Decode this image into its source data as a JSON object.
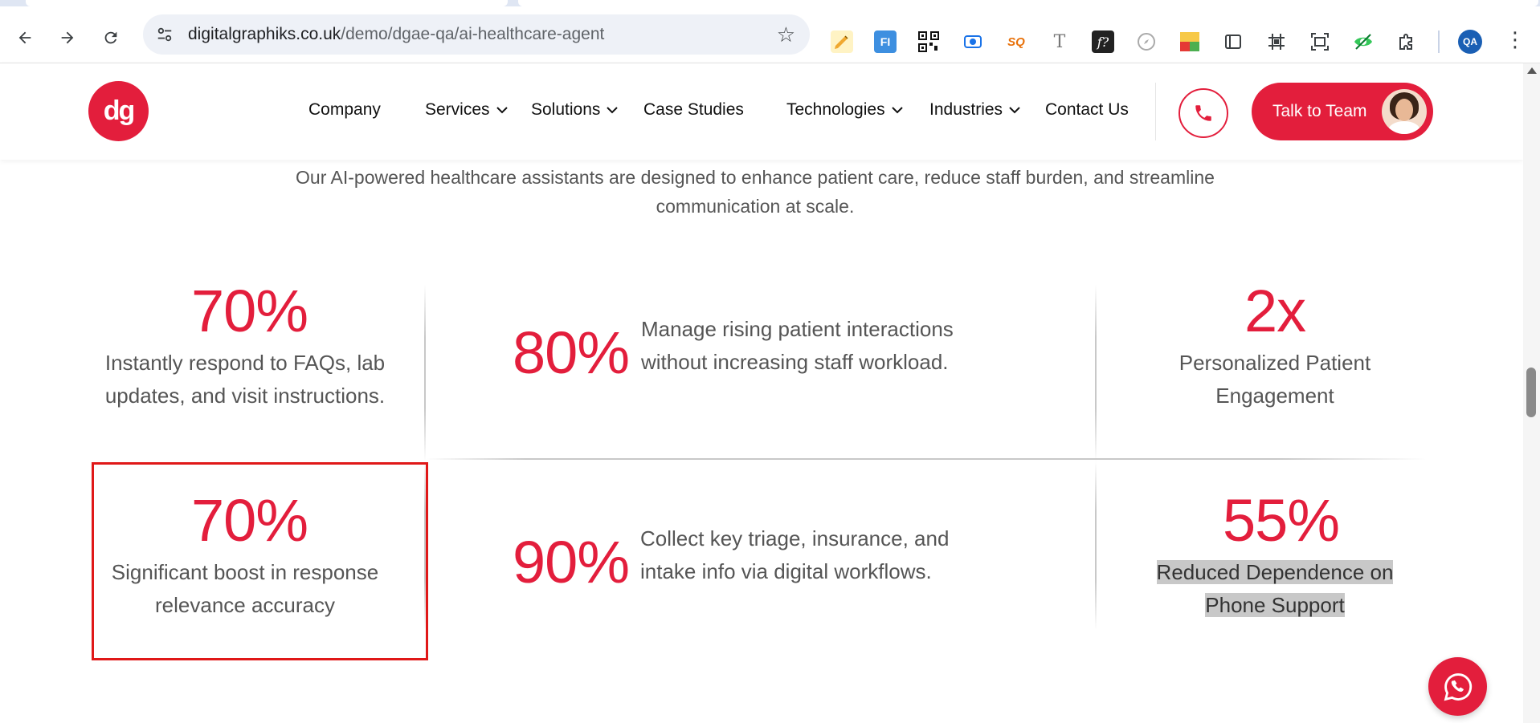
{
  "browser": {
    "url_host": "digitalgraphiks.co.uk",
    "url_path": "/demo/dgae-qa/ai-healthcare-agent",
    "profile_initials": "QA",
    "extensions": [
      "pencil-extension-icon",
      "fi-extension-icon",
      "qr-code-extension-icon",
      "record-extension-icon",
      "seo-extension-icon",
      "font-t-extension-icon",
      "font-f-extension-icon",
      "compass-extension-icon",
      "checklist-extension-icon",
      "window-extension-icon",
      "grid-extension-icon",
      "screenshot-extension-icon",
      "eye-extension-icon",
      "puzzle-extension-icon"
    ],
    "accent_color": "#1a5fb4"
  },
  "header": {
    "logo_text": "dg",
    "nav": [
      {
        "label": "Company",
        "has_dropdown": false
      },
      {
        "label": "Services",
        "has_dropdown": true
      },
      {
        "label": "Solutions",
        "has_dropdown": true
      },
      {
        "label": "Case Studies",
        "has_dropdown": false
      },
      {
        "label": "Technologies",
        "has_dropdown": true
      },
      {
        "label": "Industries",
        "has_dropdown": true
      },
      {
        "label": "Contact Us",
        "has_dropdown": false
      }
    ],
    "cta_label": "Talk to Team",
    "brand_color": "#e31e3c"
  },
  "intro": {
    "line1": "Our AI-powered healthcare assistants are designed to enhance patient care, reduce staff burden, and streamline",
    "line2": "communication at scale."
  },
  "stats": [
    {
      "value": "70%",
      "text1": "Instantly respond to FAQs, lab",
      "text2": "updates, and visit instructions."
    },
    {
      "value": "80%",
      "text1": "Manage rising patient interactions",
      "text2": "without increasing staff workload."
    },
    {
      "value": "2x",
      "text1": "Personalized Patient",
      "text2": "Engagement"
    },
    {
      "value": "70%",
      "text1": "Significant boost in response",
      "text2": "relevance accuracy"
    },
    {
      "value": "90%",
      "text1": "Collect key triage, insurance, and",
      "text2": "intake info via digital workflows."
    },
    {
      "value": "55%",
      "text1": "Reduced Dependence on",
      "text2": "Phone Support"
    }
  ]
}
